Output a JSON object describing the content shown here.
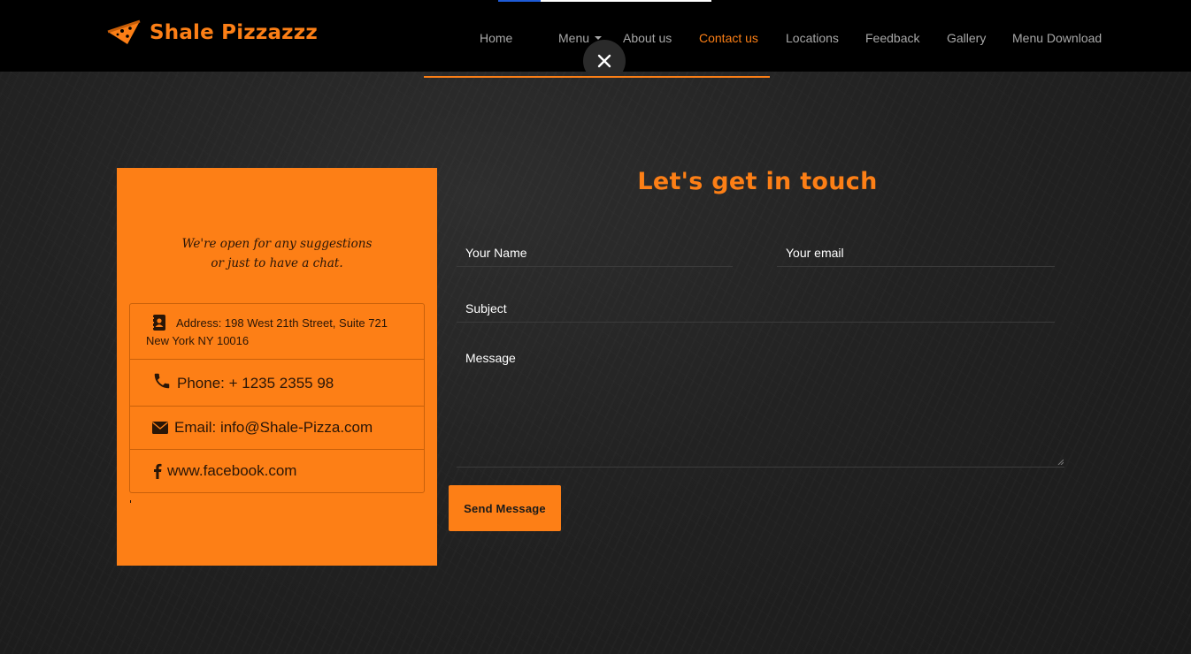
{
  "header": {
    "brand_name": "Shale Pizzazzz",
    "brand_logo_icon": "pizza-slice-icon",
    "nav": {
      "home": "Home",
      "menu": "Menu",
      "about": "About us",
      "contact": "Contact us",
      "locations": "Locations",
      "feedback": "Feedback",
      "gallery": "Gallery",
      "download": "Menu Download"
    },
    "active_item": "Contact us",
    "close_icon": "close-icon"
  },
  "contact_card": {
    "tagline_line1": "We're open for any suggestions",
    "tagline_line2": "or just to have a chat.",
    "address_line1": "Address: 198 West 21th Street, Suite 721",
    "address_line2": "New York NY 10016",
    "phone": "Phone: + 1235 2355 98",
    "email": "Email: info@Shale-Pizza.com",
    "facebook": "www.facebook.com",
    "icons": [
      "address-book-icon",
      "phone-icon",
      "envelope-icon",
      "facebook-icon"
    ]
  },
  "form": {
    "title": "Let's get in touch",
    "name_placeholder": "Your Name",
    "email_placeholder": "Your email",
    "subject_placeholder": "Subject",
    "message_placeholder": "Message",
    "submit_label": "Send Message"
  },
  "colors": {
    "accent": "#fc7f16",
    "card_bg": "#fd7f16",
    "topbar_bg": "#000000",
    "nav_text": "#a8a8a8"
  }
}
